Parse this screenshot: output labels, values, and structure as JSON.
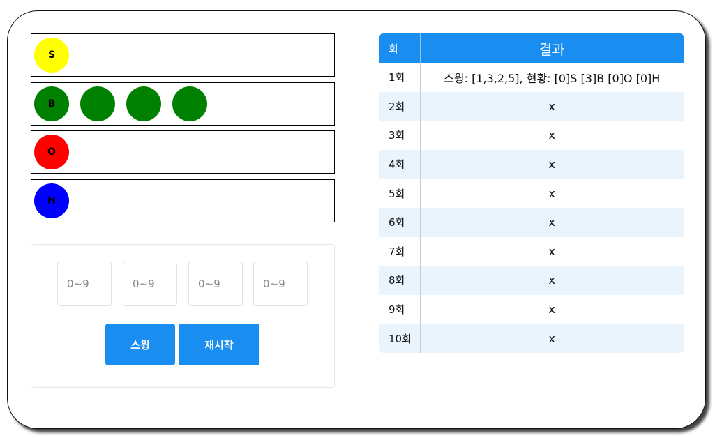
{
  "rows": {
    "strike": {
      "label": "S",
      "color": "#ffff00",
      "count": 0
    },
    "ball": {
      "label": "B",
      "color": "#008000",
      "count": 3
    },
    "out": {
      "label": "O",
      "color": "#ff0000",
      "count": 0
    },
    "homerun": {
      "label": "H",
      "color": "#0000ff",
      "count": 0
    }
  },
  "inputs": [
    {
      "placeholder": "0~9",
      "value": ""
    },
    {
      "placeholder": "0~9",
      "value": ""
    },
    {
      "placeholder": "0~9",
      "value": ""
    },
    {
      "placeholder": "0~9",
      "value": ""
    }
  ],
  "buttons": {
    "swing_label": "스윙",
    "restart_label": "재시작"
  },
  "table": {
    "headers": {
      "round": "회",
      "result": "결과"
    },
    "rows": [
      {
        "round": "1회",
        "result": "스윙: [1,3,2,5], 현황: [0]S [3]B [0]O [0]H"
      },
      {
        "round": "2회",
        "result": "x"
      },
      {
        "round": "3회",
        "result": "x"
      },
      {
        "round": "4회",
        "result": "x"
      },
      {
        "round": "5회",
        "result": "x"
      },
      {
        "round": "6회",
        "result": "x"
      },
      {
        "round": "7회",
        "result": "x"
      },
      {
        "round": "8회",
        "result": "x"
      },
      {
        "round": "9회",
        "result": "x"
      },
      {
        "round": "10회",
        "result": "x"
      }
    ]
  }
}
